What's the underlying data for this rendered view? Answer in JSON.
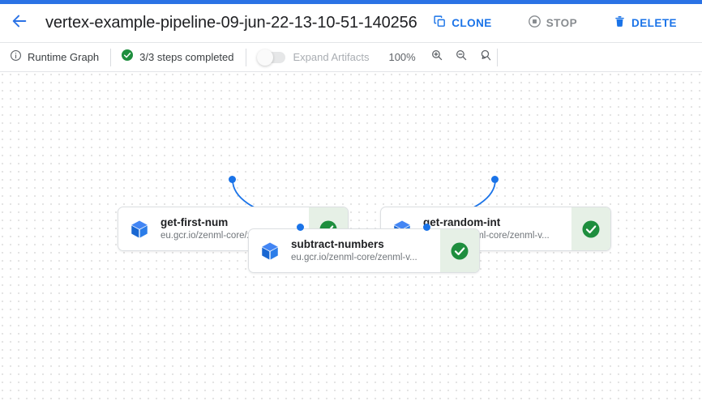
{
  "window": {
    "accent_color": "#2a72e5"
  },
  "header": {
    "back_icon": "arrow-left-icon",
    "title": "vertex-example-pipeline-09-jun-22-13-10-51-140256",
    "actions": [
      {
        "id": "clone",
        "label": "CLONE",
        "icon": "copy-icon",
        "color": "#1a73e8",
        "disabled": false
      },
      {
        "id": "stop",
        "label": "STOP",
        "icon": "stop-circle-icon",
        "color": "#888c90",
        "disabled": true
      },
      {
        "id": "delete",
        "label": "DELETE",
        "icon": "trash-icon",
        "color": "#1a73e8",
        "disabled": false
      }
    ]
  },
  "toolbar": {
    "graph_mode": {
      "icon": "info-circle-icon",
      "label": "Runtime Graph"
    },
    "status": {
      "icon": "check-circle-icon",
      "label": "3/3 steps completed",
      "color": "#1e8e3e"
    },
    "expand_artifacts": {
      "label": "Expand Artifacts",
      "enabled": false,
      "on": false
    },
    "zoom": {
      "level": "100%",
      "buttons": [
        {
          "id": "zoom-in",
          "icon": "zoom-in-icon"
        },
        {
          "id": "zoom-out",
          "icon": "zoom-out-icon"
        },
        {
          "id": "zoom-reset",
          "icon": "zoom-reset-icon"
        }
      ]
    }
  },
  "graph": {
    "node_icon": "cube-icon",
    "status_icon": "check-circle-icon",
    "status_color": "#1e8e3e",
    "status_bg": "#e6f0e6",
    "edge_color": "#1a73e8",
    "nodes": [
      {
        "id": "get-first-num",
        "title": "get-first-num",
        "subtitle": "eu.gcr.io/zenml-core/zenml-v...",
        "status": "succeeded"
      },
      {
        "id": "get-random-int",
        "title": "get-random-int",
        "subtitle": "eu.gcr.io/zenml-core/zenml-v...",
        "status": "succeeded"
      },
      {
        "id": "subtract-numbers",
        "title": "subtract-numbers",
        "subtitle": "eu.gcr.io/zenml-core/zenml-v...",
        "status": "succeeded"
      }
    ],
    "edges": [
      {
        "from": "get-first-num",
        "to": "subtract-numbers"
      },
      {
        "from": "get-random-int",
        "to": "subtract-numbers"
      }
    ]
  }
}
